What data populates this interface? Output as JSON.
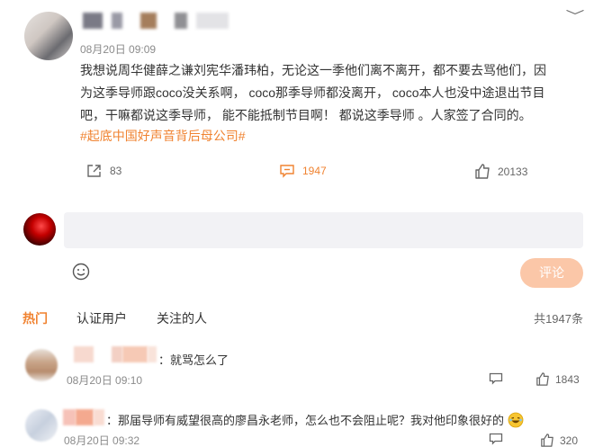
{
  "post": {
    "time": "08月20日 09:09",
    "body": "我想说周华健薛之谦刘宪华潘玮柏，无论这一季他们离不离开，都不要去骂他们，因为这季导师跟coco没关系啊， coco那季导师都没离开， coco本人也没中途退出节目吧，干嘛都说这季导师， 能不能抵制节目啊！ 都说这季导师 。人家签了合同的。",
    "topic": "#起底中国好声音背后母公司#",
    "shares": "83",
    "comments": "1947",
    "likes": "20133"
  },
  "reply": {
    "placeholder": "",
    "submit_label": "评论"
  },
  "tabs": {
    "hot": "热门",
    "verified": "认证用户",
    "following": "关注的人",
    "total": "共1947条"
  },
  "comments": [
    {
      "text": "：就骂怎么了",
      "time": "08月20日 09:10",
      "likes": "1843"
    },
    {
      "text": "：那届导师有威望很高的廖昌永老师，怎么也不会阻止呢？我对他印象很好的",
      "time": "08月20日 09:32",
      "likes": "320"
    }
  ],
  "colors": {
    "accent": "#f08331",
    "button_disabled": "#fbc7a8",
    "input_bg": "#f2f2f5"
  }
}
